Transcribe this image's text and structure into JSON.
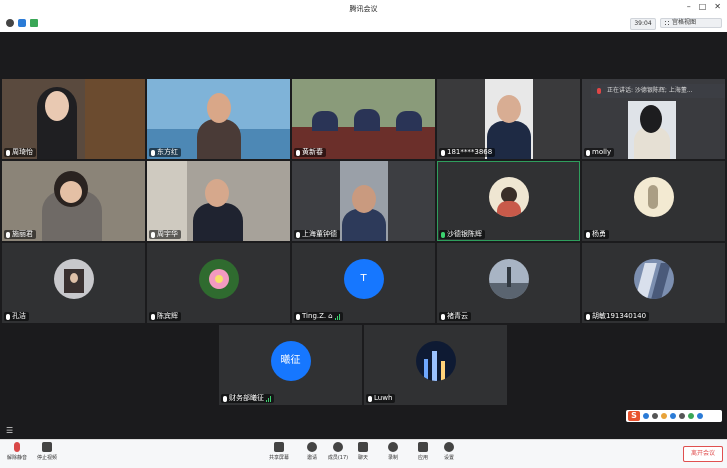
{
  "window": {
    "title": "腾讯会议",
    "timer": "39:04",
    "view_label": "宫格视图"
  },
  "speaking_banner": "正在讲话: 沙德银陈辉; 上海董...",
  "participants": [
    {
      "name": "周琦怡",
      "kind": "video"
    },
    {
      "name": "东方红",
      "kind": "video"
    },
    {
      "name": "黄新春",
      "kind": "video"
    },
    {
      "name": "181****3868",
      "kind": "video"
    },
    {
      "name": "molly",
      "kind": "video"
    },
    {
      "name": "施丽君",
      "kind": "video"
    },
    {
      "name": "周宇华",
      "kind": "video"
    },
    {
      "name": "上海董钟德",
      "kind": "video"
    },
    {
      "name": "沙德银陈辉",
      "kind": "avatar"
    },
    {
      "name": "杨勇",
      "kind": "avatar"
    },
    {
      "name": "孔洁",
      "kind": "avatar"
    },
    {
      "name": "陈宾辉",
      "kind": "avatar"
    },
    {
      "name": "Ting.Z.",
      "kind": "letter",
      "letter": "T"
    },
    {
      "name": "褚青云",
      "kind": "avatar"
    },
    {
      "name": "胡敏191340140",
      "kind": "avatar"
    },
    {
      "name": "财务部曦征",
      "kind": "letter",
      "letter": "曦征"
    },
    {
      "name": "Luwh",
      "kind": "avatar"
    }
  ],
  "toolbar": {
    "unmute": "解除静音",
    "start_video": "停止视频",
    "share": "共享屏幕",
    "invite": "邀请",
    "members": "成员(17)",
    "chat": "聊天",
    "record": "录制",
    "apps": "应用",
    "settings": "设置",
    "leave": "离开会议"
  },
  "colors": {
    "accent": "#1677ff",
    "leave": "#e05050",
    "active_speaker": "#2f9e5d"
  }
}
